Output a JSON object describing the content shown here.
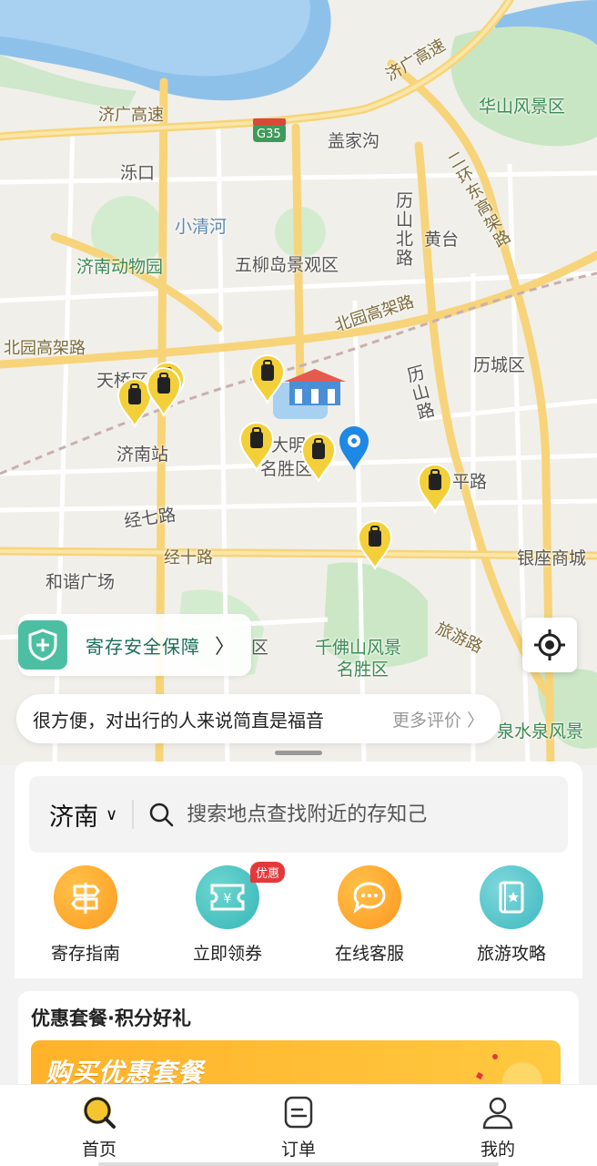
{
  "map": {
    "labels": {
      "jiguang_highway_top": "济广高速",
      "jiguang_highway_left": "济广高速",
      "huashan": "华山风景区",
      "gaishigou": "盖家沟",
      "luokou": "泺口",
      "xiaoqinghe": "小清河",
      "huangtai": "黄台",
      "east_ring": "二环东高架路",
      "zoo": "济南动物园",
      "wuliudao": "五柳岛景观区",
      "lishan_north": "历山北路",
      "beiyuan_left": "北园高架路",
      "beiyuan_mid": "北园高架路",
      "licheng": "历城区",
      "tianqiao": "天桥区",
      "jinan_station": "济南站",
      "lishan_rd": "历山路",
      "daming": "大明湖",
      "mingsheng": "名胜区",
      "heping": "和平路",
      "jingqi": "经七路",
      "jingshi": "经十路",
      "yinzuo": "银座商城",
      "hexie": "和谐广场",
      "qianfoshan": "千佛山风景",
      "qianfoshan2": "名胜区",
      "lvyou": "旅游路",
      "quanshui": "泉水泉风景",
      "shizhong": "区",
      "g35": "G35"
    }
  },
  "safety": {
    "label": "寄存安全保障",
    "arrow": "〉"
  },
  "review": {
    "quote": "很方便，对出行的人来说简直是福音",
    "more": "更多评价 〉"
  },
  "search": {
    "city": "济南",
    "caret": "∨",
    "placeholder": "搜索地点查找附近的存知己"
  },
  "shortcuts": [
    {
      "label": "寄存指南",
      "color": "#ffa92a"
    },
    {
      "label": "立即领券",
      "color": "#45c3c0",
      "badge": "优惠"
    },
    {
      "label": "在线客服",
      "color": "#ffa52a"
    },
    {
      "label": "旅游攻略",
      "color": "#4ec1c6"
    }
  ],
  "promo": {
    "title": "优惠套餐·积分好礼",
    "banner": "购买优惠套餐"
  },
  "nav": [
    {
      "label": "首页",
      "icon": "search-icon"
    },
    {
      "label": "订单",
      "icon": "order-icon"
    },
    {
      "label": "我的",
      "icon": "user-icon"
    }
  ]
}
